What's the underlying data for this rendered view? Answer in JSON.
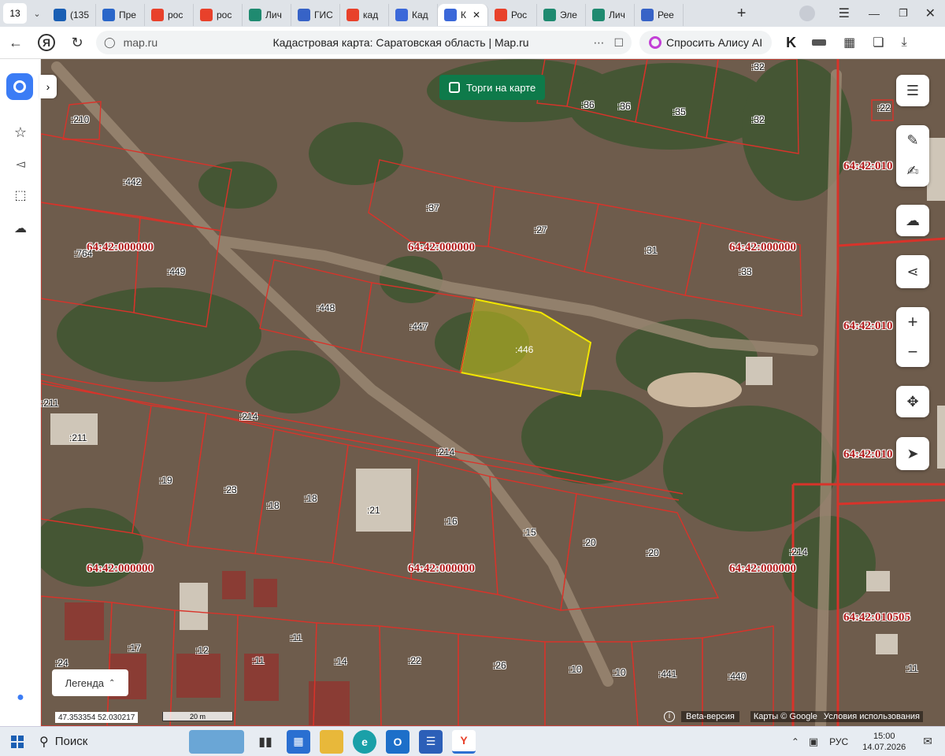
{
  "browser": {
    "tab_count": "13",
    "tabs": [
      {
        "label": "(135",
        "color": "#1a5fb4",
        "icon": "mail-icon"
      },
      {
        "label": "Пре",
        "color": "#2a66c9",
        "icon": "globe-icon"
      },
      {
        "label": "рос",
        "color": "#e8412b",
        "icon": "yandex-icon"
      },
      {
        "label": "рос",
        "color": "#e8412b",
        "icon": "yandex-icon"
      },
      {
        "label": "Лич",
        "color": "#1f8a70",
        "icon": "gosuslugi-icon"
      },
      {
        "label": "ГИС",
        "color": "#3763c7",
        "icon": "emblem-icon"
      },
      {
        "label": "кад",
        "color": "#e8412b",
        "icon": "yandex-icon"
      },
      {
        "label": "Кад",
        "color": "#3b68d9",
        "icon": "mapru-icon"
      },
      {
        "label": "К",
        "color": "#3b68d9",
        "icon": "mapru-icon",
        "active": true
      },
      {
        "label": "Рос",
        "color": "#e8412b",
        "icon": "yandex-icon"
      },
      {
        "label": "Эле",
        "color": "#1f8a70",
        "icon": "gosuslugi-icon"
      },
      {
        "label": "Лич",
        "color": "#1f8a70",
        "icon": "gosuslugi-icon"
      },
      {
        "label": "Рее",
        "color": "#3763c7",
        "icon": "emblem-icon"
      }
    ],
    "url": "map.ru",
    "page_title": "Кадастровая карта: Саратовская область | Map.ru",
    "alice_label": "Спросить Алису AI"
  },
  "map": {
    "torgi_label": "Торги на карте",
    "legend_label": "Легенда",
    "coords": "47.353354   52.030217",
    "scale": "20 m",
    "beta": "Beta-версия",
    "attribution": "Карты © Google",
    "terms": "Условия использования",
    "highlight_color": "#f2e600",
    "boundary_color": "#d8332a",
    "quarters": [
      "64:42:000000",
      "64:42:000000",
      "64:42:000000",
      "64:42:000000",
      "64:42:000000",
      "64:42:000000",
      "64:42:000000",
      "64:42:010505",
      "64:42:010",
      "64:42:010",
      "64:42:010"
    ],
    "parcels": [
      ":210",
      ":442",
      ":764",
      ":449",
      ":37",
      ":27",
      ":31",
      ":33",
      ":448",
      ":447",
      ":446",
      ":36",
      ":36",
      ":35",
      ":32",
      ":32",
      ":35",
      ":22",
      ":211",
      ":211",
      ":214",
      ":214",
      ":214",
      ":19",
      ":23",
      ":18",
      ":18",
      ":21",
      ":16",
      ":15",
      ":20",
      ":20",
      ":24",
      ":17",
      ":12",
      ":11",
      ":11",
      ":14",
      ":22",
      ":26",
      ":10",
      ":10",
      ":441",
      ":440",
      ":11",
      ":15"
    ]
  },
  "taskbar": {
    "search": "Поиск",
    "lang": "РУС",
    "time": "15:00",
    "date": "14.07.2026"
  }
}
